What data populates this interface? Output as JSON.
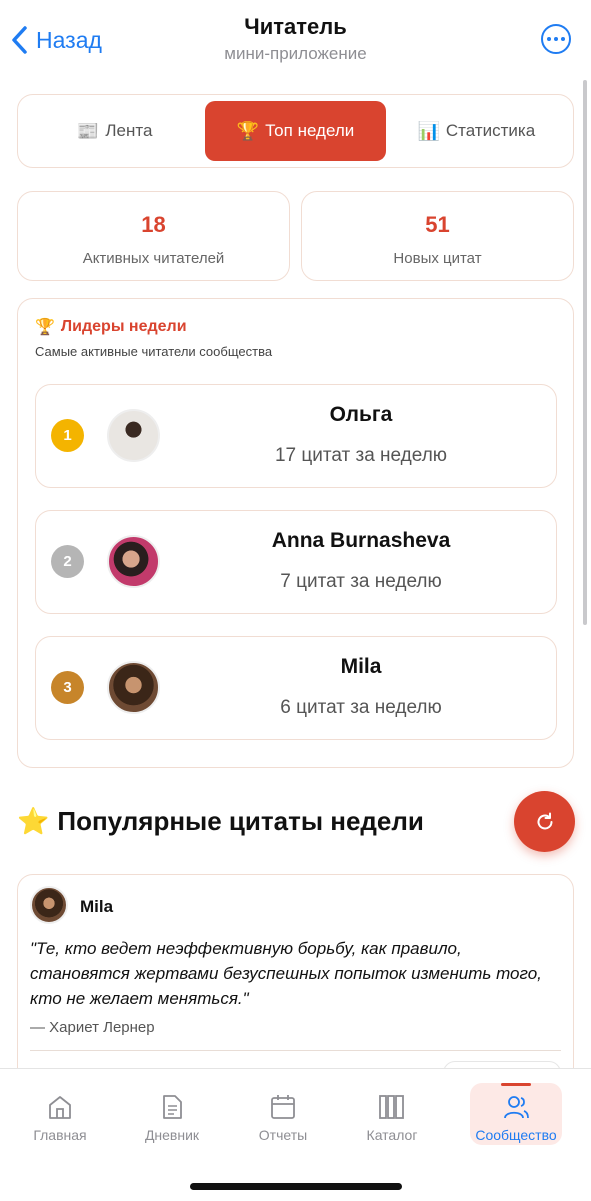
{
  "header": {
    "back_label": "Назад",
    "title": "Читатель",
    "subtitle": "мини-приложение"
  },
  "tabs": [
    {
      "label": "Лента",
      "icon": "newspaper-icon",
      "emoji": "📰",
      "active": false
    },
    {
      "label": "Топ недели",
      "icon": "trophy-icon",
      "emoji": "🏆",
      "active": true
    },
    {
      "label": "Статистика",
      "icon": "chart-icon",
      "emoji": "📊",
      "active": false
    }
  ],
  "stats": [
    {
      "value": "18",
      "label": "Активных читателей"
    },
    {
      "value": "51",
      "label": "Новых цитат"
    }
  ],
  "leaders": {
    "emoji": "🏆",
    "title": "Лидеры недели",
    "subtitle": "Самые активные читатели сообщества",
    "items": [
      {
        "rank": "1",
        "name": "Ольга",
        "count": "17 цитат за неделю"
      },
      {
        "rank": "2",
        "name": "Anna Burnasheva",
        "count": "7 цитат за неделю"
      },
      {
        "rank": "3",
        "name": "Mila",
        "count": "6 цитат за неделю"
      }
    ]
  },
  "popular": {
    "emoji": "⭐",
    "title": "Популярные цитаты недели",
    "quote": {
      "author": "Mila",
      "text": "\"Те, кто ведет неэффективную борьбу, как правило, становятся жертвами безуспешных попыток изменить того, кто не желает меняться.\"",
      "source": "— Хариет Лернер"
    }
  },
  "nav": [
    {
      "label": "Главная",
      "icon": "home-icon"
    },
    {
      "label": "Дневник",
      "icon": "document-icon"
    },
    {
      "label": "Отчеты",
      "icon": "calendar-icon"
    },
    {
      "label": "Каталог",
      "icon": "books-icon"
    },
    {
      "label": "Сообщество",
      "icon": "people-icon",
      "active": true
    }
  ],
  "colors": {
    "accent": "#d9442f",
    "link": "#1f7cf2",
    "border": "#f1ddd3",
    "gold": "#f4b400",
    "silver": "#b5b5b5",
    "bronze": "#c7852a"
  }
}
